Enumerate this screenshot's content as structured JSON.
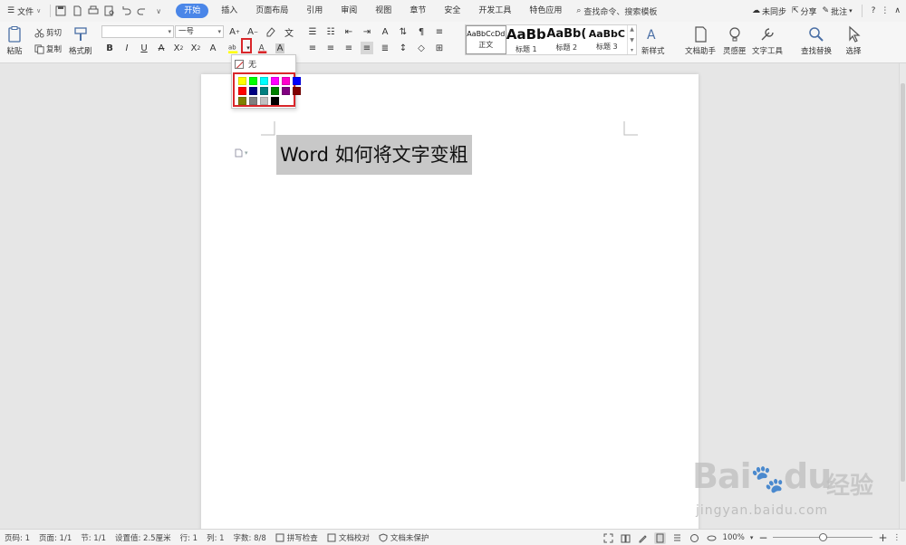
{
  "menubar": {
    "file_label": "文件",
    "tabs": [
      {
        "label": "开始",
        "active": true
      },
      {
        "label": "插入"
      },
      {
        "label": "页面布局"
      },
      {
        "label": "引用"
      },
      {
        "label": "审阅"
      },
      {
        "label": "视图"
      },
      {
        "label": "章节"
      },
      {
        "label": "安全"
      },
      {
        "label": "开发工具"
      },
      {
        "label": "特色应用"
      }
    ],
    "search_placeholder": "查找命令、搜索模板",
    "sync_label": "未同步",
    "share_label": "分享",
    "comment_label": "批注",
    "help_label": "?"
  },
  "ribbon": {
    "paste_label": "粘贴",
    "cut_label": "剪切",
    "copy_label": "复制",
    "format_painter_label": "格式刷",
    "font_name_value": "",
    "font_size_value": "一号",
    "bold": "B",
    "italic": "I",
    "underline": "U",
    "styles": [
      {
        "preview": "AaBbCcDd",
        "name": "正文",
        "selected": true
      },
      {
        "preview": "AaBb",
        "name": "标题 1"
      },
      {
        "preview": "AaBb(",
        "name": "标题 2"
      },
      {
        "preview": "AaBbC",
        "name": "标题 3"
      }
    ],
    "new_style_label": "新样式",
    "doc_assistant_label": "文档助手",
    "inspiration_label": "灵感匣",
    "text_tools_label": "文字工具",
    "find_replace_label": "查找替换",
    "select_label": "选择"
  },
  "highlight_dropdown": {
    "none_label": "无",
    "colors": [
      "#ffff00",
      "#00ff00",
      "#00ffff",
      "#ff00ff",
      "#ff00cc",
      "#0000ff",
      "#ff0000",
      "#000080",
      "#008080",
      "#008000",
      "#800080",
      "#800000",
      "#808000",
      "#808080",
      "#c0c0c0",
      "#000000"
    ]
  },
  "document": {
    "text": "Word 如何将文字变粗"
  },
  "statusbar": {
    "page_num": "页码: 1",
    "pages": "页面: 1/1",
    "section": "节: 1/1",
    "setting": "设置值: 2.5厘米",
    "row": "行: 1",
    "col": "列: 1",
    "word_count": "字数: 8/8",
    "spell_check": "拼写检查",
    "doc_proof": "文档校对",
    "doc_protect": "文档未保护",
    "zoom": "100%",
    "zoom_fraction": 0.5
  },
  "watermark": {
    "brand": "Bai",
    "brand2": "du",
    "cn": "经验",
    "url": "jingyan.baidu.com"
  },
  "colors": {
    "accent": "#4a86e8",
    "highlight_frame": "#d9262a",
    "selection": "#c8c8c8"
  }
}
